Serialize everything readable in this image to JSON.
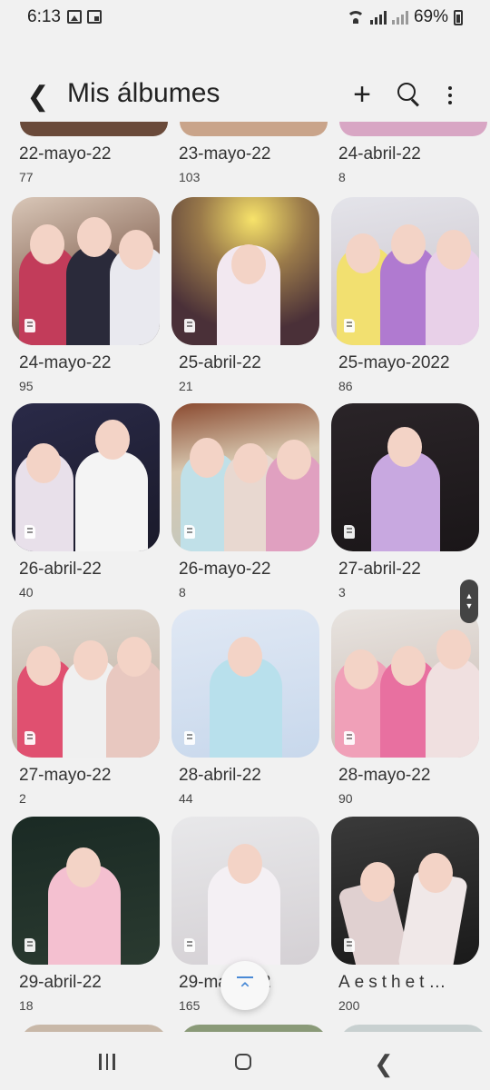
{
  "status_bar": {
    "time": "6:13",
    "battery": "69%"
  },
  "app_bar": {
    "title": "Mis álbumes"
  },
  "albums": [
    {
      "name": "22-mayo-22",
      "count": "77"
    },
    {
      "name": "23-mayo-22",
      "count": "103"
    },
    {
      "name": "24-abril-22",
      "count": "8"
    },
    {
      "name": "24-mayo-22",
      "count": "95"
    },
    {
      "name": "25-abril-22",
      "count": "21"
    },
    {
      "name": "25-mayo-2022",
      "count": "86"
    },
    {
      "name": "26-abril-22",
      "count": "40"
    },
    {
      "name": "26-mayo-22",
      "count": "8"
    },
    {
      "name": "27-abril-22",
      "count": "3"
    },
    {
      "name": "27-mayo-22",
      "count": "2"
    },
    {
      "name": "28-abril-22",
      "count": "44"
    },
    {
      "name": "28-mayo-22",
      "count": "90"
    },
    {
      "name": "29-abril-22",
      "count": "18"
    },
    {
      "name": "29-mayo-22",
      "count": "165"
    },
    {
      "name": "Aesthet…",
      "count": "200"
    }
  ],
  "colors": {
    "background": "#f1f1f1",
    "accent": "#4a8ad6"
  },
  "icons": {
    "back": "back-arrow-icon",
    "add": "plus-icon",
    "search": "search-icon",
    "more": "more-options-icon",
    "sd_card": "sd-card-icon",
    "scroll_top": "scroll-to-top-icon"
  }
}
